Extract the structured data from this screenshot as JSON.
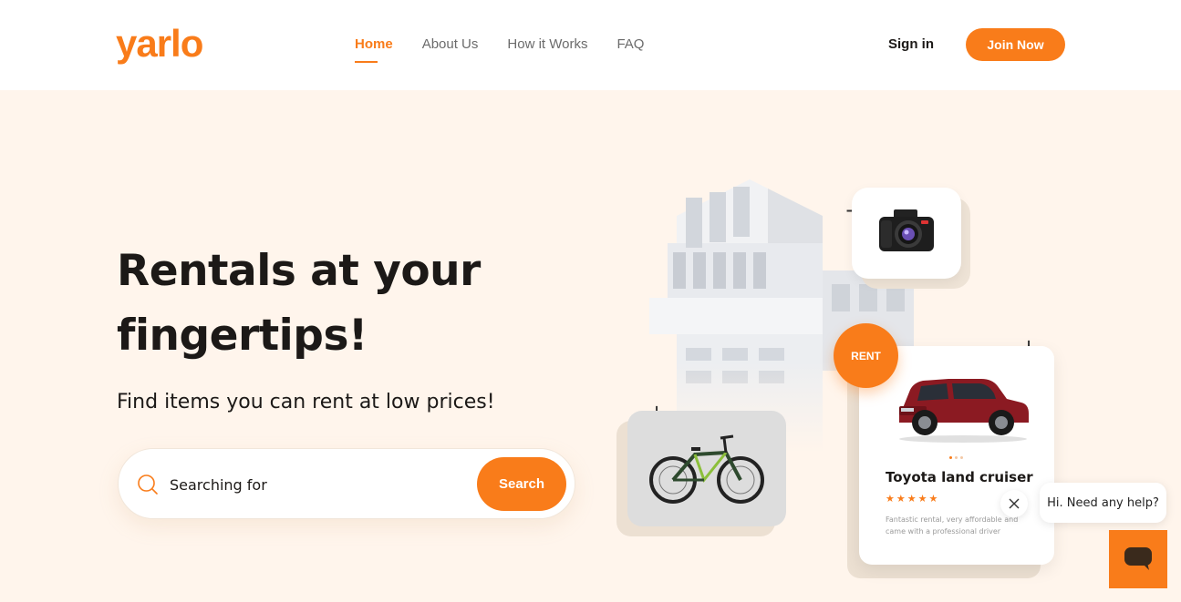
{
  "header": {
    "logo": "yarlo",
    "nav": [
      "Home",
      "About Us",
      "How it Works",
      "FAQ"
    ],
    "active_nav": "Home",
    "signin_label": "Sign in",
    "join_label": "Join Now"
  },
  "hero": {
    "title": "Rentals at your fingertips!",
    "subtitle": "Find items you can rent at low prices!"
  },
  "search": {
    "placeholder": "Searching for",
    "button_label": "Search"
  },
  "illustration": {
    "rent_badge": "RENT",
    "product_card": {
      "title": "Toyota land cruiser",
      "rating": 5,
      "stars": "★★★★★",
      "description": "Fantastic rental, very affordable and came with a professional driver"
    }
  },
  "chat": {
    "greeting": "Hi. Need any help?"
  },
  "colors": {
    "accent": "#f97c1a",
    "hero_background": "#fff5ec"
  },
  "icons": [
    "search-icon",
    "camera-icon",
    "bicycle-icon",
    "car-icon",
    "close-icon",
    "chat-icon",
    "plus-icon"
  ]
}
